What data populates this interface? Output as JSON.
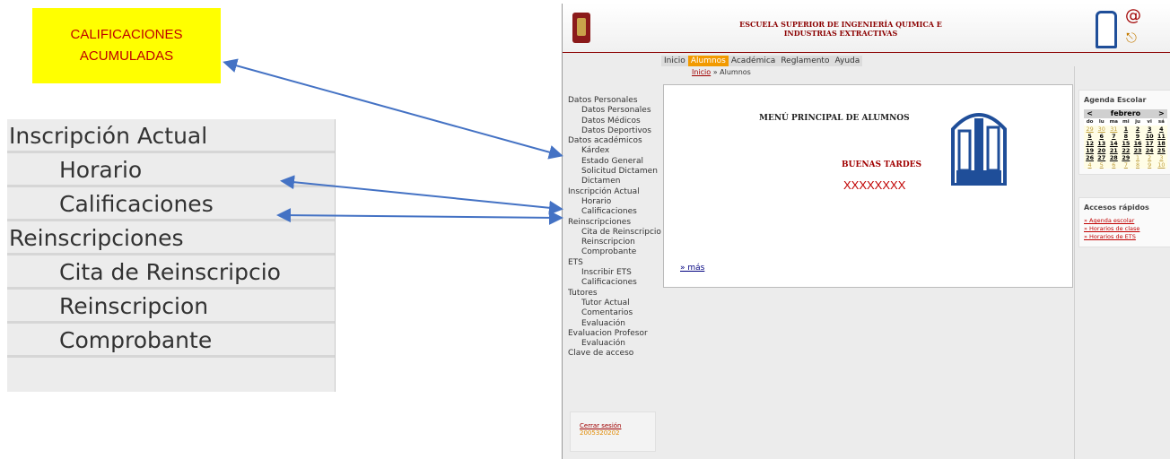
{
  "callout": {
    "line1": "CALIFICACIONES",
    "line2": "ACUMULADAS"
  },
  "zoom_menu": [
    {
      "label": "Inscripción Actual",
      "level": "header"
    },
    {
      "label": "Horario",
      "level": "sub"
    },
    {
      "label": "Calificaciones",
      "level": "sub"
    },
    {
      "label": "Reinscripciones",
      "level": "header"
    },
    {
      "label": "Cita de Reinscripcio",
      "level": "sub"
    },
    {
      "label": "Reinscripcion",
      "level": "sub"
    },
    {
      "label": "Comprobante",
      "level": "sub"
    }
  ],
  "header": {
    "title_line1": "ESCUELA SUPERIOR DE INGENIERÍA QUIMICA E",
    "title_line2": "INDUSTRIAS EXTRACTIVAS",
    "at_symbol": "@"
  },
  "nav": {
    "items": [
      "Inicio",
      "Alumnos",
      "Académica",
      "Reglamento",
      "Ayuda"
    ],
    "active": "Alumnos"
  },
  "breadcrumb": {
    "home": "Inicio",
    "sep": " » ",
    "current": "Alumnos"
  },
  "left_menu": [
    {
      "label": "Datos Personales",
      "level": "header"
    },
    {
      "label": "Datos Personales",
      "level": "sub"
    },
    {
      "label": "Datos Médicos",
      "level": "sub"
    },
    {
      "label": "Datos Deportivos",
      "level": "sub"
    },
    {
      "label": "Datos académicos",
      "level": "header"
    },
    {
      "label": "Kárdex",
      "level": "sub"
    },
    {
      "label": "Estado General",
      "level": "sub"
    },
    {
      "label": "Solicitud Dictamen",
      "level": "sub"
    },
    {
      "label": "Dictamen",
      "level": "sub"
    },
    {
      "label": "Inscripción Actual",
      "level": "header"
    },
    {
      "label": "Horario",
      "level": "sub"
    },
    {
      "label": "Calificaciones",
      "level": "sub"
    },
    {
      "label": "Reinscripciones",
      "level": "header"
    },
    {
      "label": "Cita de Reinscripcio",
      "level": "sub"
    },
    {
      "label": "Reinscripcion",
      "level": "sub"
    },
    {
      "label": "Comprobante",
      "level": "sub"
    },
    {
      "label": "ETS",
      "level": "header"
    },
    {
      "label": "Inscribir ETS",
      "level": "sub"
    },
    {
      "label": "Calificaciones",
      "level": "sub"
    },
    {
      "label": "Tutores",
      "level": "header"
    },
    {
      "label": "Tutor Actual",
      "level": "sub"
    },
    {
      "label": "Comentarios",
      "level": "sub"
    },
    {
      "label": "Evaluación",
      "level": "sub"
    },
    {
      "label": "Evaluacion Profesor",
      "level": "header"
    },
    {
      "label": "Evaluación",
      "level": "sub"
    },
    {
      "label": "Clave de acceso",
      "level": "header"
    }
  ],
  "session": {
    "logout_label": "Cerrar sesión",
    "user_id": "2005320202"
  },
  "main": {
    "title": "MENÚ PRINCIPAL DE ALUMNOS",
    "greeting": "BUENAS TARDES",
    "student_name": "XXXXXXXX",
    "more_link": "» más"
  },
  "agenda": {
    "title": "Agenda Escolar",
    "prev": "<",
    "month": "febrero",
    "next": ">",
    "day_headers": [
      "do",
      "lu",
      "ma",
      "mi",
      "ju",
      "vi",
      "sá"
    ],
    "weeks": [
      [
        "29",
        "30",
        "31",
        "1",
        "2",
        "3",
        "4"
      ],
      [
        "5",
        "6",
        "7",
        "8",
        "9",
        "10",
        "11"
      ],
      [
        "12",
        "13",
        "14",
        "15",
        "16",
        "17",
        "18"
      ],
      [
        "19",
        "20",
        "21",
        "22",
        "23",
        "24",
        "25"
      ],
      [
        "26",
        "27",
        "28",
        "29",
        "1",
        "2",
        "3"
      ],
      [
        "4",
        "5",
        "6",
        "7",
        "8",
        "9",
        "10"
      ]
    ]
  },
  "quick_links": {
    "title": "Accesos rápidos",
    "links": [
      "» Agenda escolar",
      "» Horarios de clase",
      "» Horarios de ETS"
    ]
  },
  "colors": {
    "accent": "#a00000",
    "nav_active": "#f29a00",
    "arrow": "#4472c4",
    "callout_bg": "#ffff00"
  }
}
